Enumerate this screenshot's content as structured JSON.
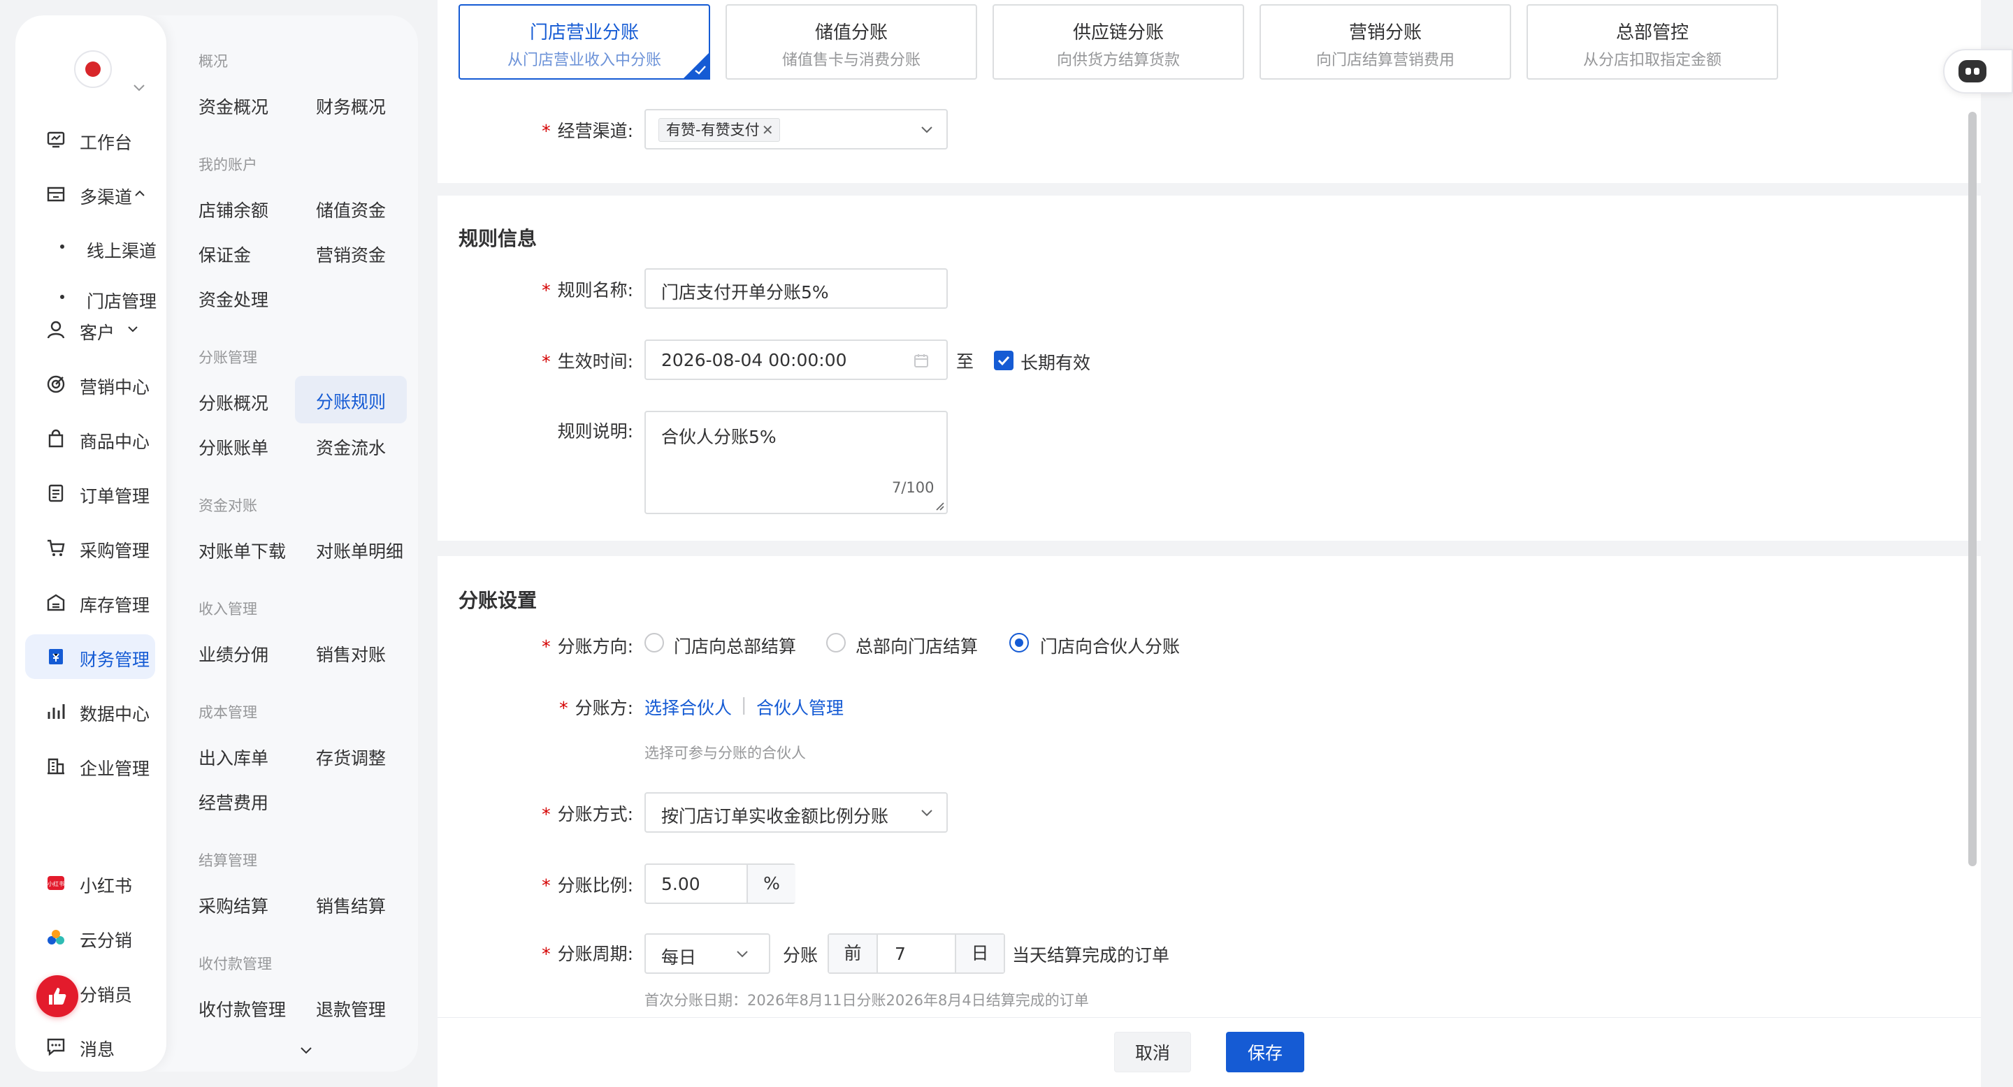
{
  "rail": {
    "items": [
      {
        "label": "工作台",
        "icon": "workbench-icon"
      },
      {
        "label": "多渠道",
        "icon": "store-icon"
      },
      {
        "label": "线上渠道",
        "icon": "bullet"
      },
      {
        "label": "门店管理",
        "icon": "bullet"
      },
      {
        "label": "客户",
        "icon": "user-icon"
      },
      {
        "label": "营销中心",
        "icon": "target-icon"
      },
      {
        "label": "商品中心",
        "icon": "bag-icon"
      },
      {
        "label": "订单管理",
        "icon": "order-icon"
      },
      {
        "label": "采购管理",
        "icon": "cart-icon"
      },
      {
        "label": "库存管理",
        "icon": "warehouse-icon"
      },
      {
        "label": "财务管理",
        "icon": "finance-icon"
      },
      {
        "label": "数据中心",
        "icon": "bar-chart-icon"
      },
      {
        "label": "企业管理",
        "icon": "building-icon"
      },
      {
        "label": "小红书",
        "icon": "xiaohongshu-icon"
      },
      {
        "label": "云分销",
        "icon": "cloud-distribution-icon"
      },
      {
        "label": "分销员",
        "icon": "distributor-icon"
      },
      {
        "label": "消息",
        "icon": "message-icon"
      }
    ],
    "active": "财务管理",
    "xiaohongshu_logo_text": "小红书"
  },
  "subnav": {
    "sections": [
      {
        "title": "概况",
        "links": [
          "资金概况",
          "财务概况"
        ]
      },
      {
        "title": "我的账户",
        "links": [
          "店铺余额",
          "储值资金",
          "保证金",
          "营销资金",
          "资金处理"
        ]
      },
      {
        "title": "分账管理",
        "links": [
          "分账概况",
          "分账规则",
          "分账账单",
          "资金流水"
        ]
      },
      {
        "title": "资金对账",
        "links": [
          "对账单下载",
          "对账单明细"
        ]
      },
      {
        "title": "收入管理",
        "links": [
          "业绩分佣",
          "销售对账"
        ]
      },
      {
        "title": "成本管理",
        "links": [
          "出入库单",
          "存货调整",
          "经营费用"
        ]
      },
      {
        "title": "结算管理",
        "links": [
          "采购结算",
          "销售结算"
        ]
      },
      {
        "title": "收付款管理",
        "links": [
          "收付款管理",
          "退款管理"
        ]
      }
    ],
    "active": "分账规则"
  },
  "tabs": [
    {
      "title": "门店营业分账",
      "desc": "从门店营业收入中分账",
      "active": true
    },
    {
      "title": "储值分账",
      "desc": "储值售卡与消费分账",
      "active": false
    },
    {
      "title": "供应链分账",
      "desc": "向供货方结算货款",
      "active": false
    },
    {
      "title": "营销分账",
      "desc": "向门店结算营销费用",
      "active": false
    },
    {
      "title": "总部管控",
      "desc": "从分店扣取指定金额",
      "active": false
    }
  ],
  "channel": {
    "label": "经营渠道:",
    "tag": "有赞-有赞支付"
  },
  "rule_info": {
    "title": "规则信息",
    "name_label": "规则名称:",
    "name_value": "门店支付开单分账5%",
    "time_label": "生效时间:",
    "time_value": "2026-08-04 00:00:00",
    "to": "至",
    "long_term": "长期有效",
    "desc_label": "规则说明:",
    "desc_value": "合伙人分账5%",
    "desc_count": "7/100"
  },
  "split": {
    "title": "分账设置",
    "direction_label": "分账方向:",
    "directions": [
      "门店向总部结算",
      "总部向门店结算",
      "门店向合伙人分账"
    ],
    "selected_direction": "门店向合伙人分账",
    "party_label": "分账方:",
    "select_partner": "选择合伙人",
    "separator": "|",
    "manage_partner": "合伙人管理",
    "party_hint": "选择可参与分账的合伙人",
    "method_label": "分账方式:",
    "method_value": "按门店订单实收金额比例分账",
    "ratio_label": "分账比例:",
    "ratio_value": "5.00",
    "ratio_unit": "%",
    "cycle_label": "分账周期:",
    "cycle_value": "每日",
    "cycle_text1": "分账",
    "cycle_prefix": "前",
    "cycle_days": "7",
    "cycle_unit": "日",
    "cycle_text2": "当天结算完成的订单",
    "cycle_hint": "首次分账日期：2026年8月11日分账2026年8月4日结算完成的订单"
  },
  "footer": {
    "cancel": "取消",
    "save": "保存"
  },
  "colors": {
    "accent": "#155bd4",
    "required": "#d40000",
    "background": "#f2f3f5"
  }
}
